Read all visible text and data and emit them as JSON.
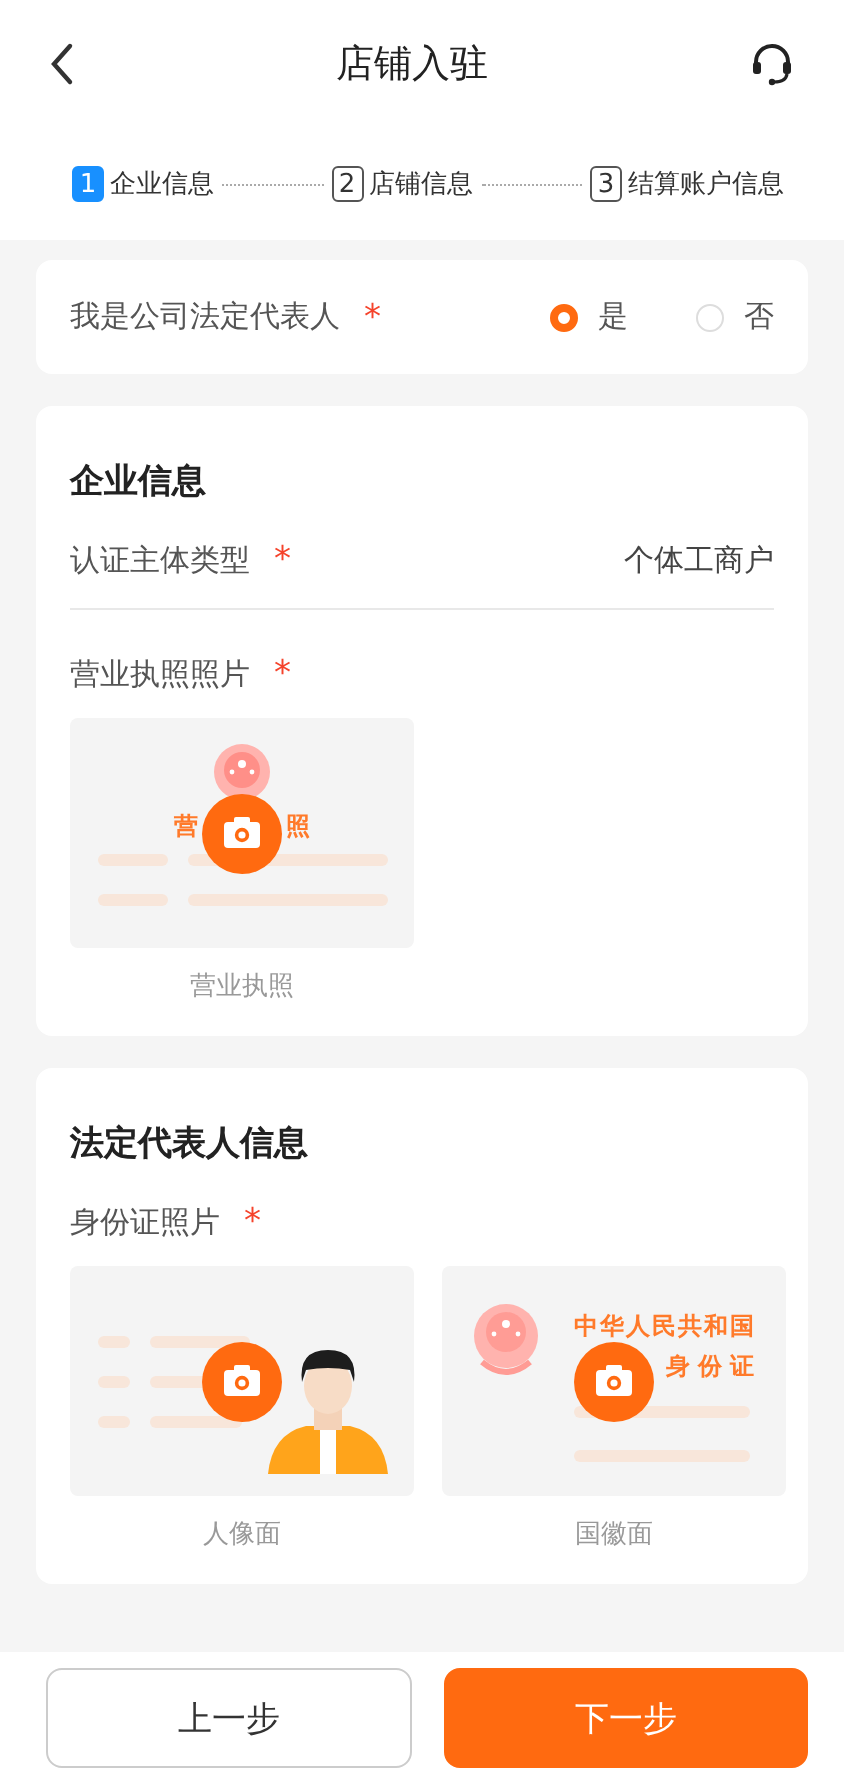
{
  "header": {
    "title": "店铺入驻"
  },
  "steps": [
    {
      "number": "1",
      "label": "企业信息",
      "selected": true
    },
    {
      "number": "2",
      "label": "店铺信息",
      "selected": false
    },
    {
      "number": "3",
      "label": "结算账户信息",
      "selected": false
    }
  ],
  "legal_rep_question": {
    "label": "我是公司法定代表人",
    "required_mark": "*",
    "options": [
      {
        "label": "是",
        "selected": true
      },
      {
        "label": "否",
        "selected": false
      }
    ]
  },
  "company_section": {
    "title": "企业信息",
    "fields": [
      {
        "label": "认证主体类型",
        "required_mark": "*",
        "value": "个体工商户"
      }
    ],
    "license": {
      "label": "营业执照照片",
      "required_mark": "*",
      "uploads": [
        {
          "kind": "license",
          "card_texts": [
            "营",
            "照"
          ],
          "caption": "营业执照"
        }
      ]
    }
  },
  "rep_section": {
    "title": "法定代表人信息",
    "id_photos": {
      "label": "身份证照片",
      "required_mark": "*",
      "uploads": [
        {
          "kind": "portrait",
          "caption": "人像面"
        },
        {
          "kind": "emblem",
          "card_texts": [
            "中华人民共和国",
            "身份证"
          ],
          "caption": "国徽面"
        }
      ]
    }
  },
  "buttons": [
    {
      "label": "上一步",
      "kind": "secondary"
    },
    {
      "label": "下一步",
      "kind": "primary"
    }
  ]
}
